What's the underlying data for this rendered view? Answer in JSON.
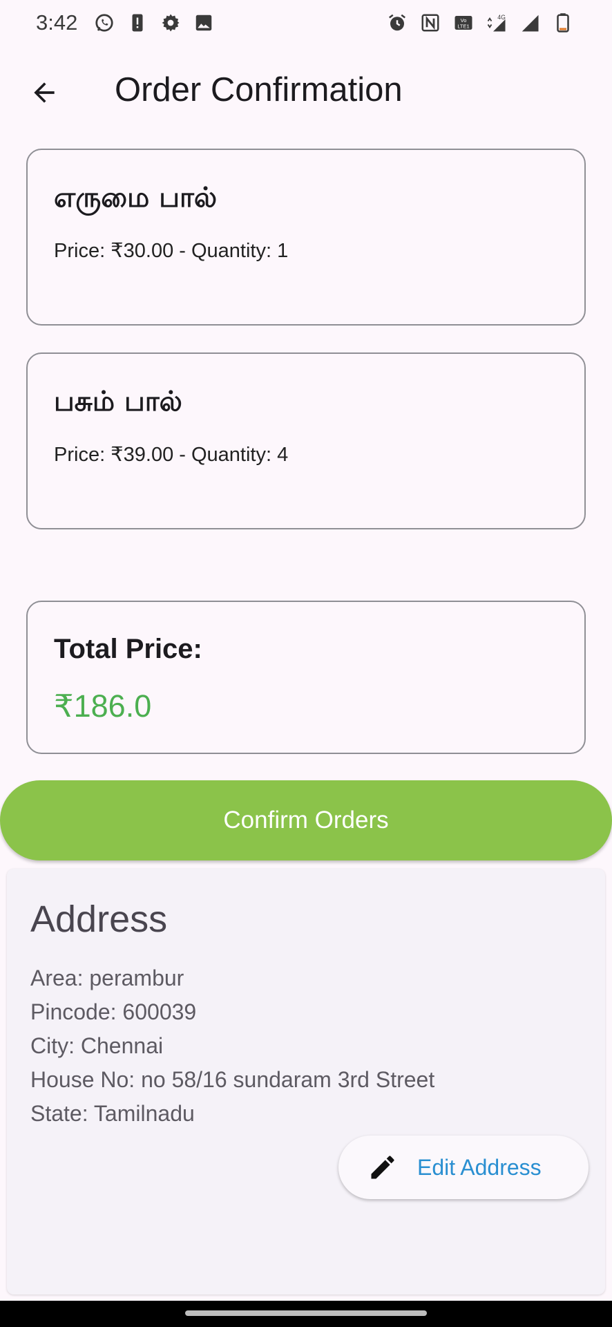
{
  "status_bar": {
    "time": "3:42",
    "left_icons": [
      "whatsapp-icon",
      "alert-icon",
      "gear-icon",
      "image-icon"
    ],
    "right_icons": [
      "alarm-icon",
      "nfc-icon",
      "volte-icon",
      "network-4g-icon",
      "signal-icon",
      "signal-icon",
      "battery-icon"
    ],
    "volte_text": "Vo LTE1",
    "network_text": "4G"
  },
  "app_bar": {
    "title": "Order Confirmation"
  },
  "orders": [
    {
      "name": "எருமை பால்",
      "meta": "Price: ₹30.00  - Quantity: 1"
    },
    {
      "name": "பசும் பால்",
      "meta": "Price: ₹39.00  - Quantity: 4"
    }
  ],
  "total": {
    "label": "Total Price:",
    "value": "₹186.0"
  },
  "confirm_button": {
    "label": "Confirm Orders"
  },
  "address": {
    "title": "Address",
    "lines": [
      "Area: perambur",
      "Pincode: 600039",
      "City: Chennai",
      "House No: no 58/16 sundaram 3rd Street",
      "State: Tamilnadu"
    ],
    "edit_label": "Edit Address"
  },
  "colors": {
    "accent_green": "#8bc34a",
    "total_green": "#4caf50",
    "link_blue": "#2a8fd1",
    "background": "#fdf7fc"
  }
}
